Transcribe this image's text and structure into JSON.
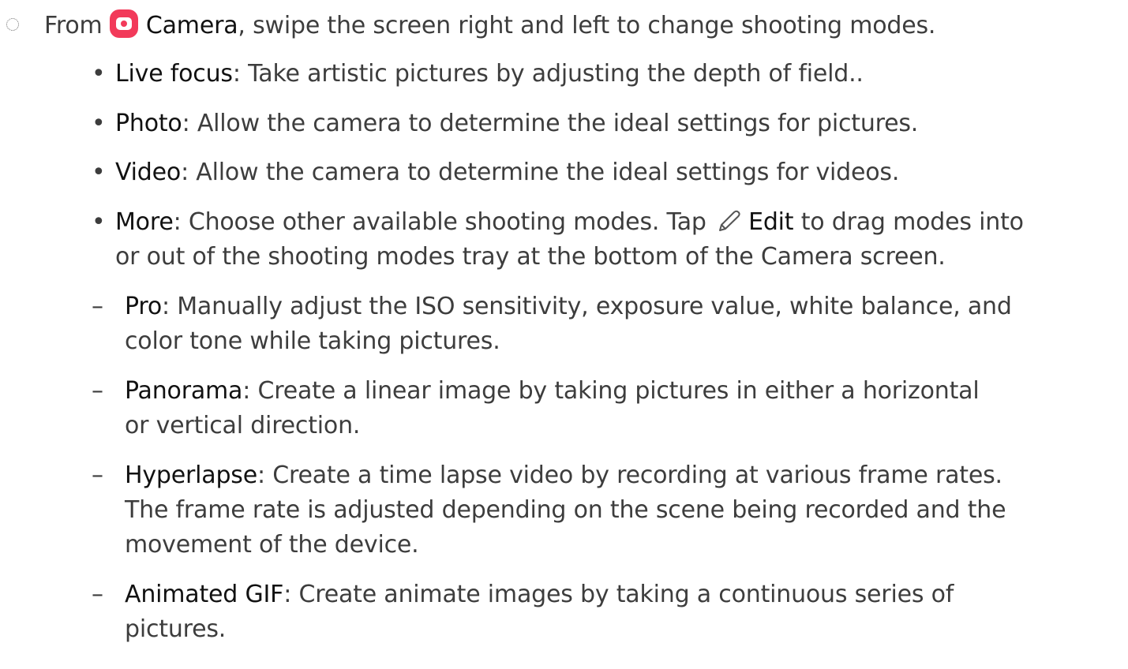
{
  "intro": {
    "from": "From",
    "app_icon": "camera-app-icon",
    "app_name": "Camera",
    "rest": ", swipe the screen right and left to change shooting modes."
  },
  "modes": [
    {
      "term": "Live focus",
      "desc": ": Take artistic pictures by adjusting the depth of field.."
    },
    {
      "term": "Photo",
      "desc": ": Allow the camera to determine the ideal settings for pictures."
    },
    {
      "term": "Video",
      "desc": ": Allow the camera to determine the ideal settings for videos."
    }
  ],
  "more": {
    "term": "More",
    "desc_a": ": Choose other available shooting modes. Tap",
    "edit_icon": "pencil-edit-icon",
    "edit_label": "Edit",
    "desc_b": "to drag modes into",
    "desc_line2": "or out of the shooting modes tray at the bottom of the Camera screen."
  },
  "sub_modes": [
    {
      "term": "Pro",
      "line1": ": Manually adjust the ISO sensitivity, exposure value, white balance, and",
      "line2": "color tone while taking pictures."
    },
    {
      "term": "Panorama",
      "line1": ": Create a linear image by taking pictures in either a horizontal",
      "line2": "or vertical direction."
    },
    {
      "term": "Hyperlapse",
      "line1": ": Create a time lapse video by recording at various frame rates.",
      "line2": "The frame rate is adjusted depending on the scene being recorded and the",
      "line3": "movement of the device."
    },
    {
      "term": "Animated GIF",
      "line1": ": Create animate images by taking a continuous series of",
      "line2": "pictures."
    }
  ],
  "markers": {
    "bullet": "•",
    "dash": "–"
  },
  "colors": {
    "camera_icon": "#f23a5a",
    "text": "#3d3d3d",
    "term": "#111111"
  }
}
